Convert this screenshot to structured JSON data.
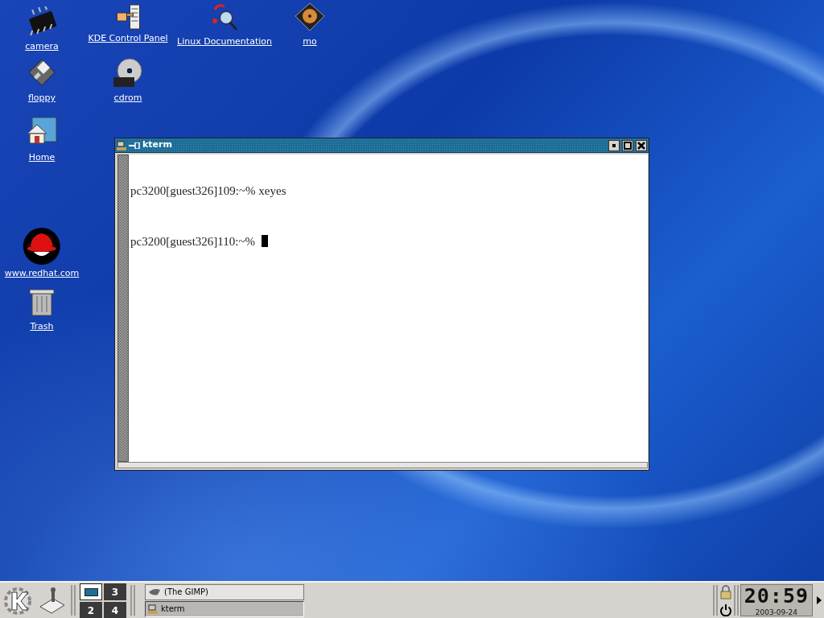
{
  "desktop_icons": [
    {
      "label": "camera",
      "kind": "chip"
    },
    {
      "label": "KDE Control Panel",
      "kind": "panel"
    },
    {
      "label": "Linux Documentation",
      "kind": "docs"
    },
    {
      "label": "mo",
      "kind": "disk"
    },
    {
      "label": "floppy",
      "kind": "floppy"
    },
    {
      "label": "cdrom",
      "kind": "cd"
    },
    {
      "label": "Home",
      "kind": "home"
    },
    {
      "label": "www.redhat.com",
      "kind": "hat"
    },
    {
      "label": "Trash",
      "kind": "trash"
    }
  ],
  "window": {
    "title": "kterm",
    "lines": [
      {
        "text": "pc3200[guest326]109:~% xeyes",
        "cursor": false
      },
      {
        "text": "pc3200[guest326]110:~%",
        "cursor": true
      }
    ]
  },
  "taskbar": {
    "desktops": [
      {
        "selected": true
      },
      {
        "label": "2",
        "selected": false
      },
      {
        "label": "3",
        "selected": false
      },
      {
        "label": "4",
        "selected": false
      }
    ],
    "tasks": [
      {
        "label": "(The GIMP)",
        "kind": "gimp",
        "selected": false
      },
      {
        "label": "kterm",
        "kind": "term",
        "selected": true
      }
    ],
    "clock": {
      "time": "20:59",
      "date": "2003-09-24"
    }
  }
}
